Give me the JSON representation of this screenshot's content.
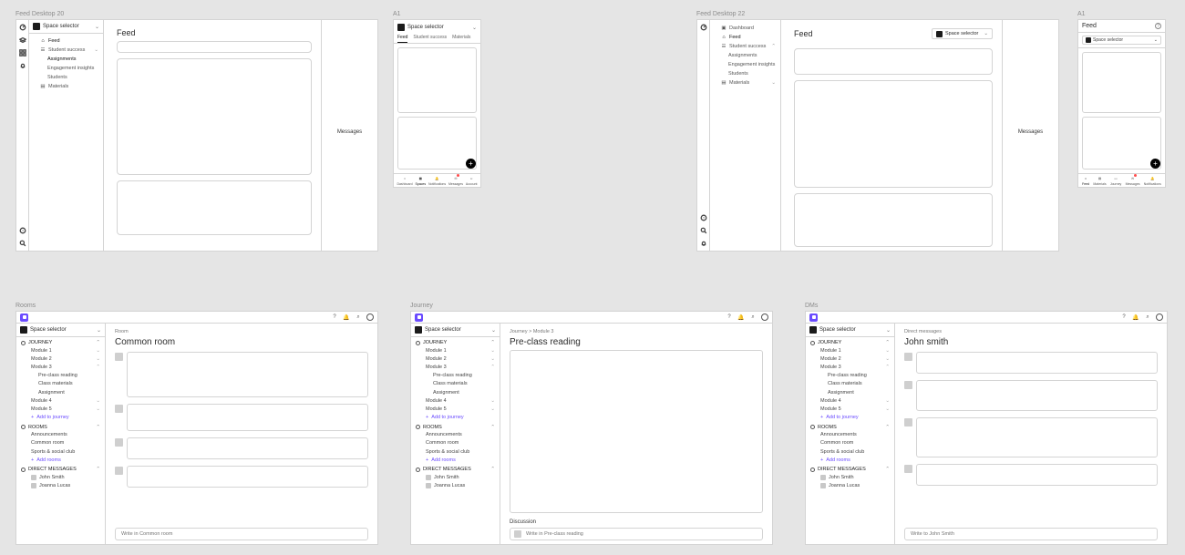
{
  "labels": {
    "feedDesktop20": "Feed Desktop 20",
    "feedDesktop22": "Feed Desktop 22",
    "a1_left": "A1",
    "a1_right": "A1",
    "rooms": "Rooms",
    "journey": "Journey",
    "dms": "DMs"
  },
  "spaceSelector": {
    "label": "Space selector"
  },
  "fd20": {
    "title": "Feed",
    "messagesPane": "Messages",
    "nav": {
      "feed": {
        "label": "Feed"
      },
      "studentSuccess": {
        "label": "Student success"
      },
      "assignments": {
        "label": "Assignments"
      },
      "engagement": {
        "label": "Engagement insights"
      },
      "students": {
        "label": "Students"
      },
      "materials": {
        "label": "Materials"
      }
    }
  },
  "fd22": {
    "title": "Feed",
    "messagesPane": "Messages",
    "nav": {
      "dashboard": {
        "label": "Dashboard"
      },
      "feed": {
        "label": "Feed"
      },
      "studentSuccess": {
        "label": "Student success"
      },
      "assignments": {
        "label": "Assignments"
      },
      "engagement": {
        "label": "Engagement insights"
      },
      "students": {
        "label": "Students"
      },
      "materials": {
        "label": "Materials"
      }
    }
  },
  "a1Left": {
    "tabs": {
      "feed": "Feed",
      "studentSuccess": "Student success",
      "materials": "Materials"
    },
    "bottom": {
      "dashboard": "Dashboard",
      "spaces": "Spaces",
      "notifications": "Notifications",
      "messages": "Messages",
      "account": "Account"
    }
  },
  "a1Right": {
    "head": "Feed",
    "bottom": {
      "feed": "Feed",
      "materials": "Materials",
      "journey": "Journey",
      "messages": "Messages",
      "notifications": "Notifications"
    }
  },
  "sidebar": {
    "journey": {
      "head": "JOURNEY",
      "items": {
        "m1": "Module 1",
        "m2": "Module 2",
        "m3": "Module 3",
        "pcr": "Pre-class reading",
        "cm": "Class materials",
        "assn": "Assignment",
        "m4": "Module 4",
        "m5": "Module 5",
        "add": "Add to journey"
      }
    },
    "rooms": {
      "head": "ROOMS",
      "items": {
        "ann": "Announcements",
        "common": "Common room",
        "sports": "Sports & social club",
        "add": "Add rooms"
      }
    },
    "dms": {
      "head": "DIRECT MESSAGES",
      "items": {
        "u1": "John Smith",
        "u2": "Joanna Lucas"
      }
    }
  },
  "roomsFrame": {
    "crumb": "Room",
    "title": "Common room",
    "composePlaceholder": "Write in Common room"
  },
  "journeyFrame": {
    "crumb": "Journey > Module 3",
    "title": "Pre-class reading",
    "discussion": "Discussion",
    "composePlaceholder": "Write in Pre-class reading"
  },
  "dmsFrame": {
    "crumb": "Direct messages",
    "title": "John smith",
    "composePlaceholder": "Write to John Smith"
  },
  "header": {
    "icons": {
      "help": "?"
    }
  }
}
